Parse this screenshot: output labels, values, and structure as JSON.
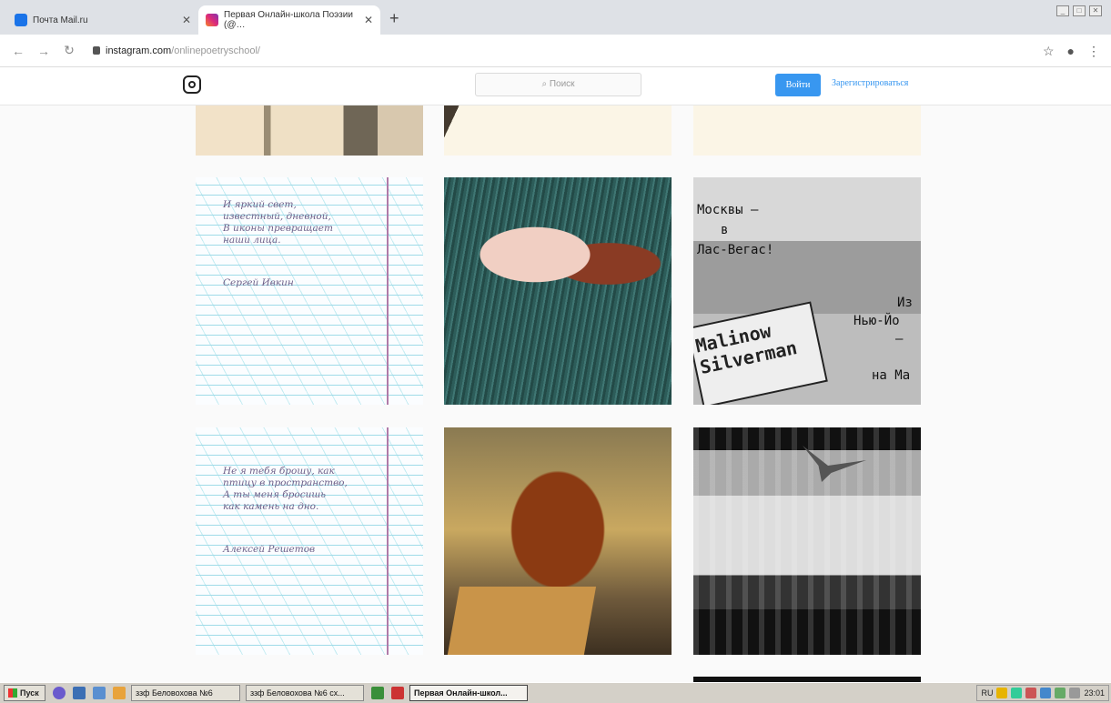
{
  "browser": {
    "tabs": [
      {
        "label": "Почта Mail.ru",
        "active": false
      },
      {
        "label": "Первая Онлайн-школа Поэзии (@…",
        "active": true
      }
    ],
    "new_tab": "+",
    "address": {
      "host": "instagram.com",
      "path": "/onlinepoetryschool/"
    }
  },
  "instagram": {
    "search_placeholder": "Поиск",
    "login_label": "Войти",
    "signup_label": "Зарегистрироваться"
  },
  "posts": {
    "poem1": {
      "text": "И яркий свет,\nизвестный, дневной,\nВ иконы превращает\nнаши лица.",
      "author": "Сергей Ивкин"
    },
    "poem2": {
      "text": "Не я тебя брошу, как\nптицу в пространство,\nА ты меня бросишь\nкак камень на дно.",
      "author": "Алексей Решетов"
    },
    "photo_caption_lines": [
      "Москвы –",
      "в",
      "Лас-Вегас!",
      "Из",
      "Нью-Йо",
      "–",
      "на Ма"
    ],
    "sign_text": [
      "Malinow",
      "Silverman"
    ]
  },
  "taskbar": {
    "start_label": "Пуск",
    "buttons": [
      "ззф Беловохова №6",
      "ззф Беловохова №6 сх...",
      "Первая Онлайн-школ..."
    ],
    "lang": "RU",
    "clock": "23:01"
  },
  "colors": {
    "accent": "#3897f0",
    "notebook_ink": "#6c5f88"
  }
}
